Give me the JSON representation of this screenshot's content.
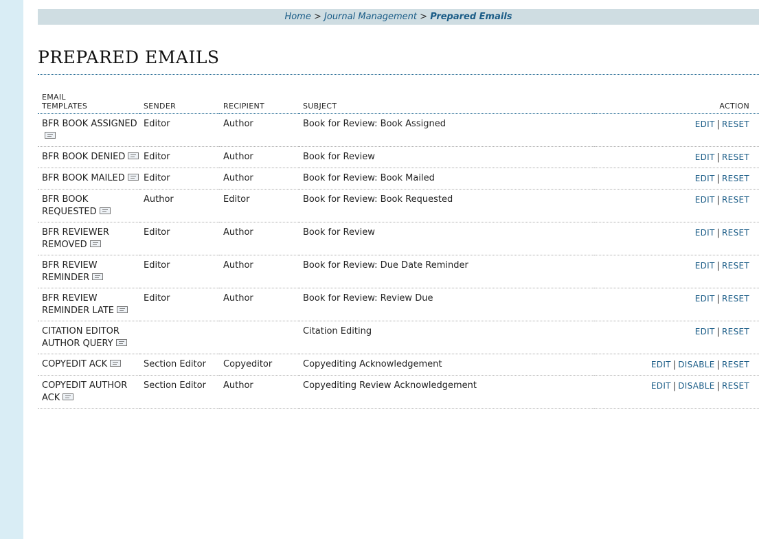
{
  "breadcrumb": {
    "home": "Home",
    "separator": ">",
    "section": "Journal Management",
    "current": "Prepared Emails"
  },
  "page_title": "PREPARED EMAILS",
  "table": {
    "headers": {
      "templates": "EMAIL TEMPLATES",
      "sender": "SENDER",
      "recipient": "RECIPIENT",
      "subject": "SUBJECT",
      "action": "ACTION"
    },
    "rows": [
      {
        "name": "BFR BOOK ASSIGNED",
        "sender": "Editor",
        "recipient": "Author",
        "subject": "Book for Review: Book Assigned",
        "actions": [
          "EDIT",
          "RESET"
        ]
      },
      {
        "name": "BFR BOOK DENIED",
        "sender": "Editor",
        "recipient": "Author",
        "subject": "Book for Review",
        "actions": [
          "EDIT",
          "RESET"
        ]
      },
      {
        "name": "BFR BOOK MAILED",
        "sender": "Editor",
        "recipient": "Author",
        "subject": "Book for Review: Book Mailed",
        "actions": [
          "EDIT",
          "RESET"
        ]
      },
      {
        "name": "BFR BOOK REQUESTED",
        "sender": "Author",
        "recipient": "Editor",
        "subject": "Book for Review: Book Requested",
        "actions": [
          "EDIT",
          "RESET"
        ]
      },
      {
        "name": "BFR REVIEWER REMOVED",
        "sender": "Editor",
        "recipient": "Author",
        "subject": "Book for Review",
        "actions": [
          "EDIT",
          "RESET"
        ]
      },
      {
        "name": "BFR REVIEW REMINDER",
        "sender": "Editor",
        "recipient": "Author",
        "subject": "Book for Review: Due Date Reminder",
        "actions": [
          "EDIT",
          "RESET"
        ]
      },
      {
        "name": "BFR REVIEW REMINDER LATE",
        "sender": "Editor",
        "recipient": "Author",
        "subject": "Book for Review: Review Due",
        "actions": [
          "EDIT",
          "RESET"
        ]
      },
      {
        "name": "CITATION EDITOR AUTHOR QUERY",
        "sender": "",
        "recipient": "",
        "subject": "Citation Editing",
        "actions": [
          "EDIT",
          "RESET"
        ]
      },
      {
        "name": "COPYEDIT ACK",
        "sender": "Section Editor",
        "recipient": "Copyeditor",
        "subject": "Copyediting Acknowledgement",
        "actions": [
          "EDIT",
          "DISABLE",
          "RESET"
        ]
      },
      {
        "name": "COPYEDIT AUTHOR ACK",
        "sender": "Section Editor",
        "recipient": "Author",
        "subject": "Copyediting Review Acknowledgement",
        "actions": [
          "EDIT",
          "DISABLE",
          "RESET"
        ]
      }
    ]
  },
  "icons": {
    "template_preview": "envelope-icon"
  },
  "colors": {
    "link": "#1a5c87",
    "breadcrumb_bg": "#cfdde2",
    "sidebar_stripe": "#d9edf5"
  }
}
